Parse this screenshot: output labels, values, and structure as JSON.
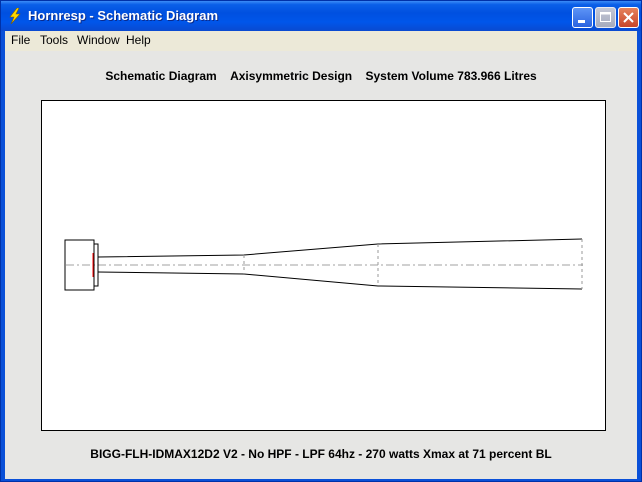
{
  "window": {
    "title": "Hornresp - Schematic Diagram"
  },
  "menu": {
    "items": [
      "File",
      "Tools",
      "Window",
      "Help"
    ]
  },
  "diagram": {
    "header_title": "Schematic Diagram",
    "design": "Axisymmetric Design",
    "system_volume": "System Volume 783.966 Litres",
    "footer_caption": "BIGG-FLH-IDMAX12D2 V2 - No HPF - LPF 64hz - 270 watts Xmax at 71 percent BL"
  },
  "colors": {
    "titlebar": "#0054e3",
    "panel": "#e6e6e4",
    "axis_line": "#a0a0a0",
    "driver_mark": "#ff0000"
  }
}
